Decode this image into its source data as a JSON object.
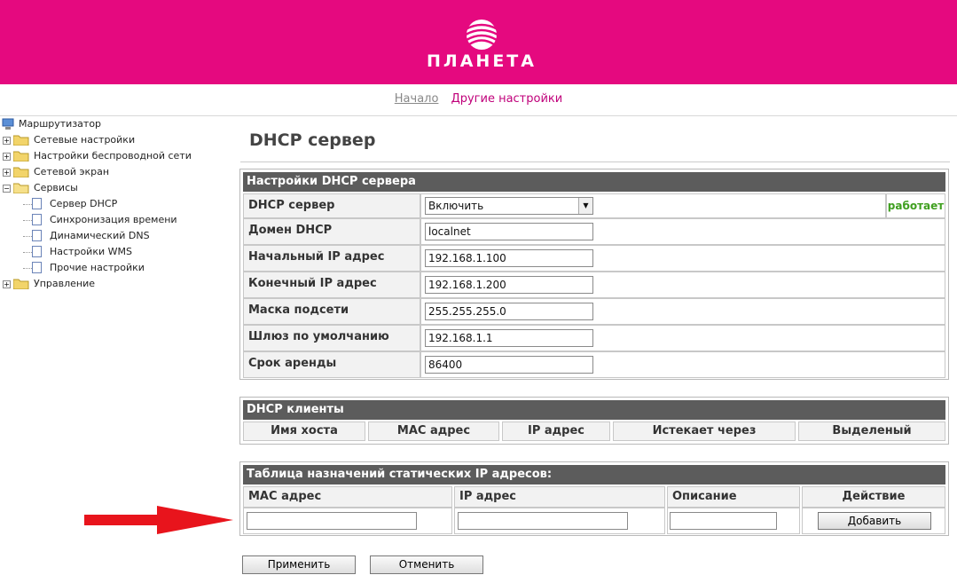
{
  "brand": {
    "name": "ПЛАНЕТА",
    "color": "#e5097f",
    "logo_icon": "planet-globe-icon"
  },
  "nav": {
    "home": "Начало",
    "other": "Другие настройки"
  },
  "sidebar": {
    "root": "Маршрутизатор",
    "items": [
      {
        "label": "Сетевые настройки",
        "expanded": false
      },
      {
        "label": "Настройки беспроводной сети",
        "expanded": false
      },
      {
        "label": "Сетевой экран",
        "expanded": false
      },
      {
        "label": "Сервисы",
        "expanded": true
      },
      {
        "label": "Управление",
        "expanded": false
      }
    ],
    "services": [
      "Сервер DHCP",
      "Синхронизация времени",
      "Динамический DNS",
      "Настройки WMS",
      "Прочие настройки"
    ]
  },
  "page": {
    "title": "DHCP сервер"
  },
  "dhcp_settings": {
    "title": "Настройки DHCP сервера",
    "server_label": "DHCP сервер",
    "server_value": "Включить",
    "server_status": "работает",
    "rows": [
      {
        "label": "Домен DHCP",
        "value": "localnet"
      },
      {
        "label": "Начальный IP адрес",
        "value": "192.168.1.100"
      },
      {
        "label": "Конечный IP адрес",
        "value": "192.168.1.200"
      },
      {
        "label": "Маска подсети",
        "value": "255.255.255.0"
      },
      {
        "label": "Шлюз по умолчанию",
        "value": "192.168.1.1"
      },
      {
        "label": "Срок аренды",
        "value": "86400"
      }
    ]
  },
  "dhcp_clients": {
    "title": "DHCP клиенты",
    "columns": [
      "Имя хоста",
      "MAC адрес",
      "IP адрес",
      "Истекает через",
      "Выделеный"
    ]
  },
  "static_table": {
    "title": "Таблица назначений статических IP адресов:",
    "columns": [
      "MAC адрес",
      "IP адрес",
      "Описание",
      "Действие"
    ],
    "add_button": "Добавить"
  },
  "actions": {
    "apply": "Применить",
    "cancel": "Отменить"
  },
  "annotation": {
    "arrow_color": "#e8141c"
  }
}
